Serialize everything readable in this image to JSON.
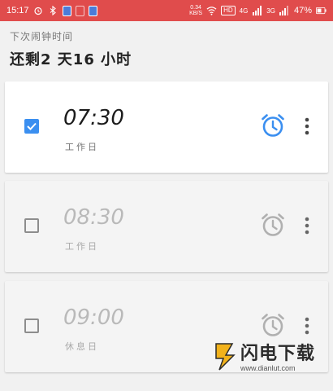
{
  "status_bar": {
    "time": "15:17",
    "speed_top": "0.34",
    "speed_bottom": "KB/S",
    "hd_label": "HD",
    "net1": "4G",
    "net2": "3G",
    "battery": "47%"
  },
  "header": {
    "next_alarm_label": "下次闹钟时间",
    "remaining_time": "还剩2 天16 小时"
  },
  "alarms": [
    {
      "time": "07:30",
      "repeat": "工作日",
      "enabled": true
    },
    {
      "time": "08:30",
      "repeat": "工作日",
      "enabled": false
    },
    {
      "time": "09:00",
      "repeat": "休息日",
      "enabled": false
    }
  ],
  "colors": {
    "status_bar": "#e04c4c",
    "accent": "#3b8ff0",
    "disabled_icon": "#b0b0b0",
    "card_bg": "#ffffff",
    "page_bg": "#f1f1f1"
  },
  "watermark": {
    "title": "闪电下载",
    "url": "www.dianlut.com"
  }
}
